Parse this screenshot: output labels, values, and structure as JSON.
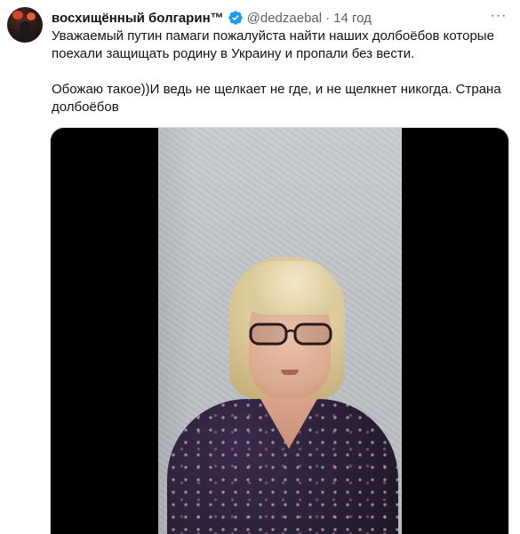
{
  "tweet": {
    "display_name": "восхищённый болгарин™",
    "handle": "@dedzaebal",
    "separator": "·",
    "time": "14 год",
    "more_label": "···",
    "text_line_1": "Уважаемый путин памаги пожалуйста найти наших долбоёбов которые поехали защищать родину в Украину и пропали без вести.",
    "text_line_2": "Обожаю такое))И ведь не щелкает не где, и не щелкнет никогда. Страна долбоёбов"
  },
  "icons": {
    "verified": "verified-badge-icon",
    "more": "more-options-icon"
  },
  "colors": {
    "verified_blue": "#1d9bf0",
    "secondary_text": "#536471",
    "primary_text": "#0f1419"
  }
}
